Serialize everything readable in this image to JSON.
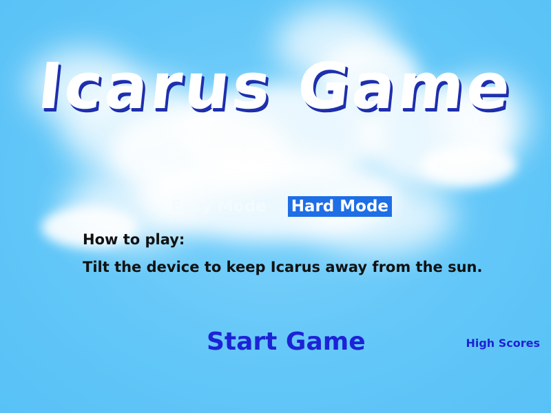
{
  "game": {
    "title": "Icarus Game"
  },
  "modes": {
    "easy_label": "Easy Mode",
    "hard_label": "Hard Mode",
    "selected": "Hard Mode"
  },
  "instructions": {
    "heading": "How to play:",
    "text": "Tilt the device to keep Icarus away from the sun."
  },
  "actions": {
    "start_label": "Start Game",
    "high_scores_label": "High Scores"
  },
  "colors": {
    "sky": "#5fc6f8",
    "title_text": "#ffffff",
    "title_shadow": "#1e2fb0",
    "selected_mode_bg": "#1e6ee6",
    "link_text": "#1d22d6",
    "instruction_text": "#111111"
  }
}
